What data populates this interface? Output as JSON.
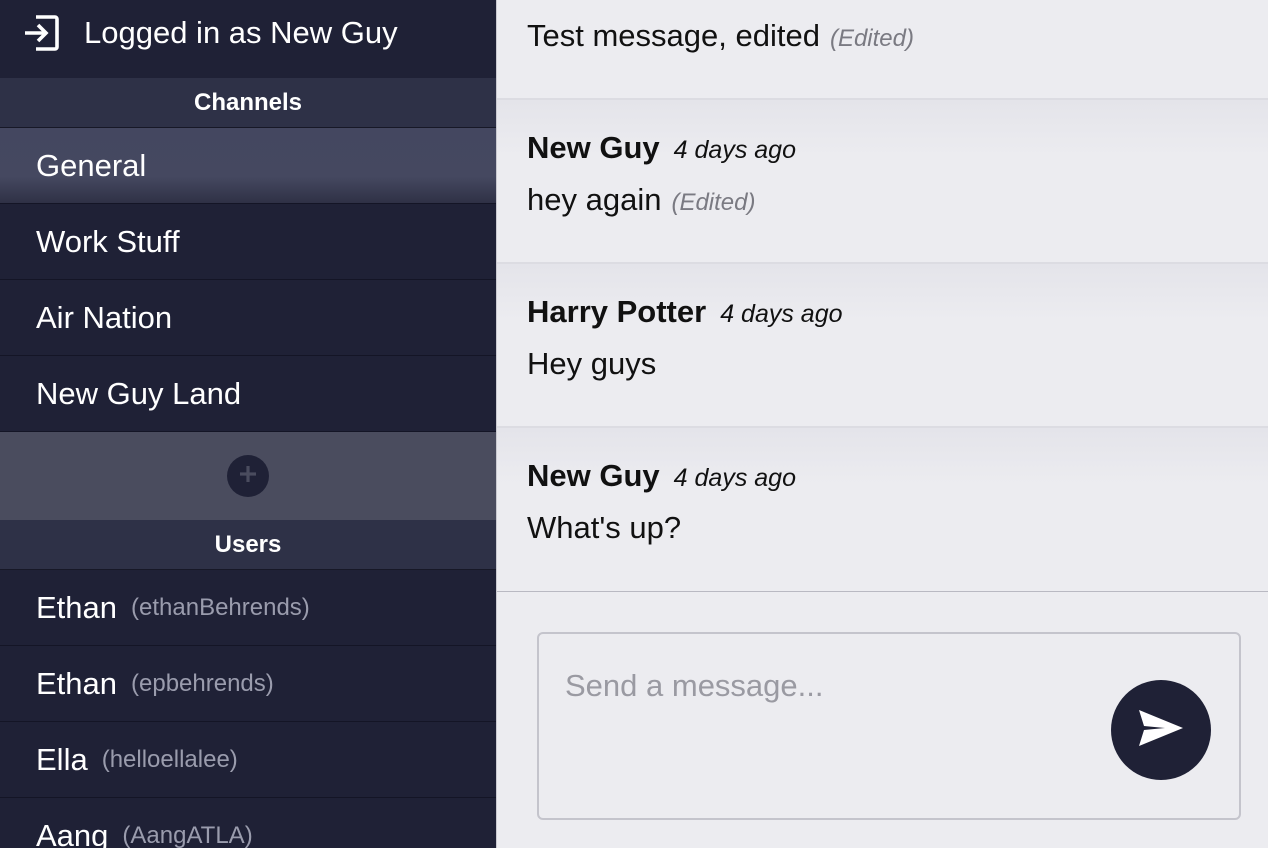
{
  "header": {
    "login_text": "Logged in as New Guy",
    "login_icon": "sign-in-icon"
  },
  "channels": {
    "title": "Channels",
    "items": [
      {
        "label": "General",
        "active": true
      },
      {
        "label": "Work Stuff",
        "active": false
      },
      {
        "label": "Air Nation",
        "active": false
      },
      {
        "label": "New Guy Land",
        "active": false
      }
    ],
    "add_icon": "plus-circle-icon"
  },
  "users": {
    "title": "Users",
    "items": [
      {
        "name": "Ethan",
        "handle": "(ethanBehrends)"
      },
      {
        "name": "Ethan",
        "handle": "(epbehrends)"
      },
      {
        "name": "Ella",
        "handle": "(helloellalee)"
      },
      {
        "name": "Aang",
        "handle": "(AangATLA)"
      }
    ]
  },
  "messages": [
    {
      "author": "",
      "time": "",
      "text": "Test message, edited",
      "edited": "(Edited)"
    },
    {
      "author": "New Guy",
      "time": "4 days ago",
      "text": "hey again",
      "edited": "(Edited)"
    },
    {
      "author": "Harry Potter",
      "time": "4 days ago",
      "text": "Hey guys",
      "edited": ""
    },
    {
      "author": "New Guy",
      "time": "4 days ago",
      "text": "What's up?",
      "edited": ""
    }
  ],
  "composer": {
    "placeholder": "Send a message...",
    "send_icon": "paper-plane-icon"
  },
  "colors": {
    "sidebar_bg": "#1f2136",
    "section_header_bg": "#2e3147",
    "active_channel_bg": "#454860",
    "main_bg": "#ececf0",
    "accent": "#1f2136"
  }
}
